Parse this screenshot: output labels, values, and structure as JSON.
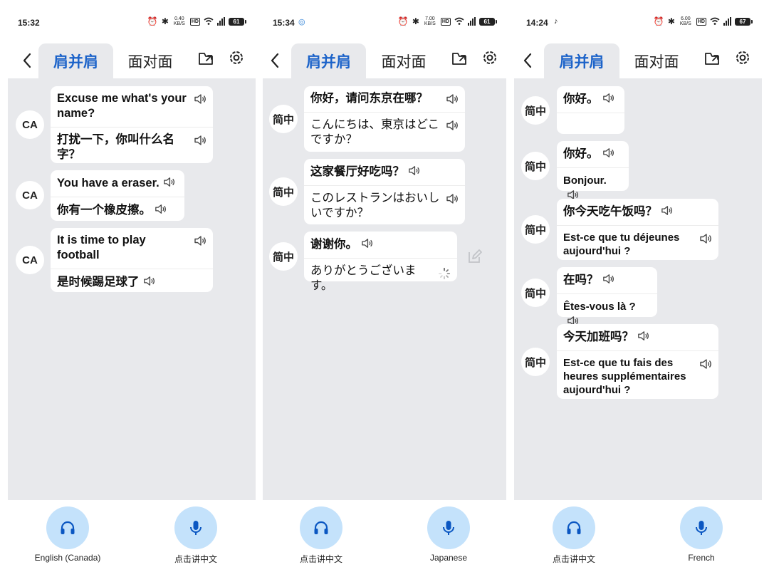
{
  "screens": [
    {
      "status_time": "15:32",
      "status_extra": "",
      "net_speed": "0.40 KB/S",
      "battery": "61",
      "tabs": [
        "肩并肩",
        "面对面"
      ],
      "messages": [
        {
          "avatar": "CA",
          "source": "Excuse me what's your name?",
          "translation": "打扰一下，你叫什么名字？"
        },
        {
          "avatar": "CA",
          "source": "You have a eraser.",
          "translation": "你有一个橡皮擦。"
        },
        {
          "avatar": "CA",
          "source": "It is time to play football",
          "translation": "是时候踢足球了"
        }
      ],
      "left_button_label": "English (Canada)",
      "right_button_label": "点击讲中文"
    },
    {
      "status_time": "15:34",
      "status_extra": "◎",
      "net_speed": "7.00 KB/S",
      "battery": "61",
      "tabs": [
        "肩并肩",
        "面对面"
      ],
      "messages": [
        {
          "avatar": "简中",
          "source": "你好，请问东京在哪？",
          "translation": "こんにちは、東京はどこですか？"
        },
        {
          "avatar": "简中",
          "source": "这家餐厅好吃吗？",
          "translation": "このレストランはおいしいですか？"
        },
        {
          "avatar": "简中",
          "source": "谢谢你。",
          "translation": "ありがとうございます。"
        }
      ],
      "left_button_label": "点击讲中文",
      "right_button_label": "Japanese"
    },
    {
      "status_time": "14:24",
      "status_extra": "♪",
      "net_speed": "6.00 KB/S",
      "battery": "67",
      "tabs": [
        "肩并肩",
        "面对面"
      ],
      "messages": [
        {
          "avatar": "简中",
          "source": "你好。",
          "translation": ""
        },
        {
          "avatar": "简中",
          "source": "你好。",
          "translation": "Bonjour."
        },
        {
          "avatar": "简中",
          "source": "你今天吃午饭吗？",
          "translation": "Est-ce que tu déjeunes aujourd'hui ?"
        },
        {
          "avatar": "简中",
          "source": "在吗？",
          "translation": "Êtes-vous là ?"
        },
        {
          "avatar": "简中",
          "source": "今天加班吗？",
          "translation": "Est-ce que tu fais des heures supplémentaires aujourd'hui ?"
        }
      ],
      "left_button_label": "点击讲中文",
      "right_button_label": "French"
    }
  ],
  "colors": {
    "accent": "#1c63c9",
    "chat_background": "#e8e9ec",
    "mic_button": "#c4e2fb",
    "card": "#ffffff"
  },
  "icons": {
    "back": "chevron-left-icon",
    "history": "folder-export-icon",
    "settings": "gear-icon",
    "speaker": "speaker-icon",
    "headphones": "headphones-icon",
    "microphone": "microphone-icon",
    "edit": "edit-icon",
    "loading": "loading-spinner-icon"
  }
}
